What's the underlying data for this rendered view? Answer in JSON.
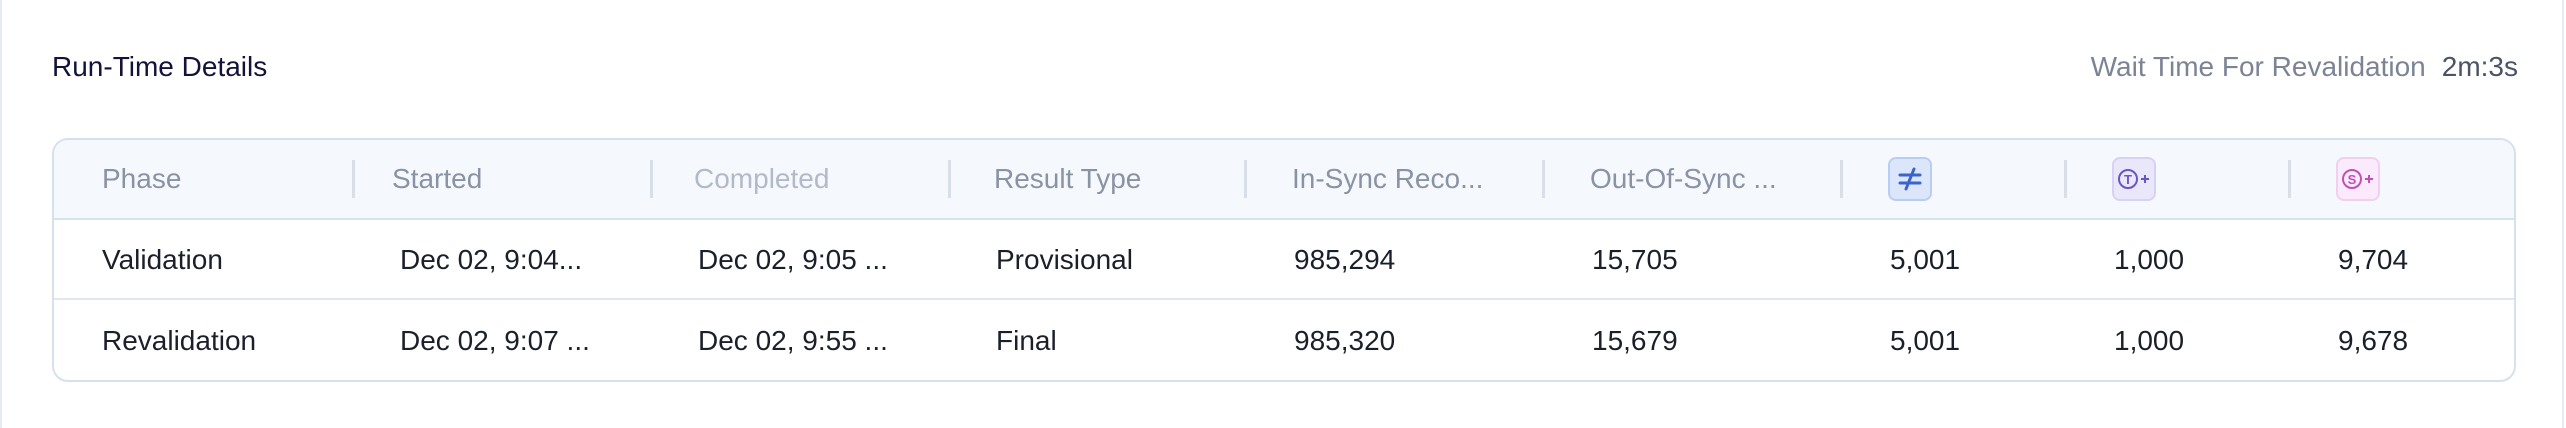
{
  "header": {
    "title": "Run-Time Details",
    "wait_label": "Wait Time For Revalidation",
    "wait_value": "2m:3s"
  },
  "table": {
    "columns": [
      {
        "label": "Phase"
      },
      {
        "label": "Started"
      },
      {
        "label": "Completed"
      },
      {
        "label": "Result Type"
      },
      {
        "label": "In-Sync Reco..."
      },
      {
        "label": "Out-Of-Sync ..."
      },
      {
        "icon": "not-equal-icon"
      },
      {
        "icon": "target-plus-icon"
      },
      {
        "icon": "source-plus-icon"
      }
    ],
    "rows": [
      {
        "phase": "Validation",
        "started": "Dec 02, 9:04...",
        "completed": "Dec 02, 9:05 ...",
        "result_type": "Provisional",
        "in_sync": "985,294",
        "out_of_sync": "15,705",
        "mismatch": "5,001",
        "target_only": "1,000",
        "source_only": "9,704"
      },
      {
        "phase": "Revalidation",
        "started": "Dec 02, 9:07 ...",
        "completed": "Dec 02, 9:55 ...",
        "result_type": "Final",
        "in_sync": "985,320",
        "out_of_sync": "15,679",
        "mismatch": "5,001",
        "target_only": "1,000",
        "source_only": "9,678"
      }
    ]
  },
  "colors": {
    "accent_blue": "#3b63c9",
    "accent_purple": "#6a55c4",
    "accent_pink": "#c050b8"
  }
}
